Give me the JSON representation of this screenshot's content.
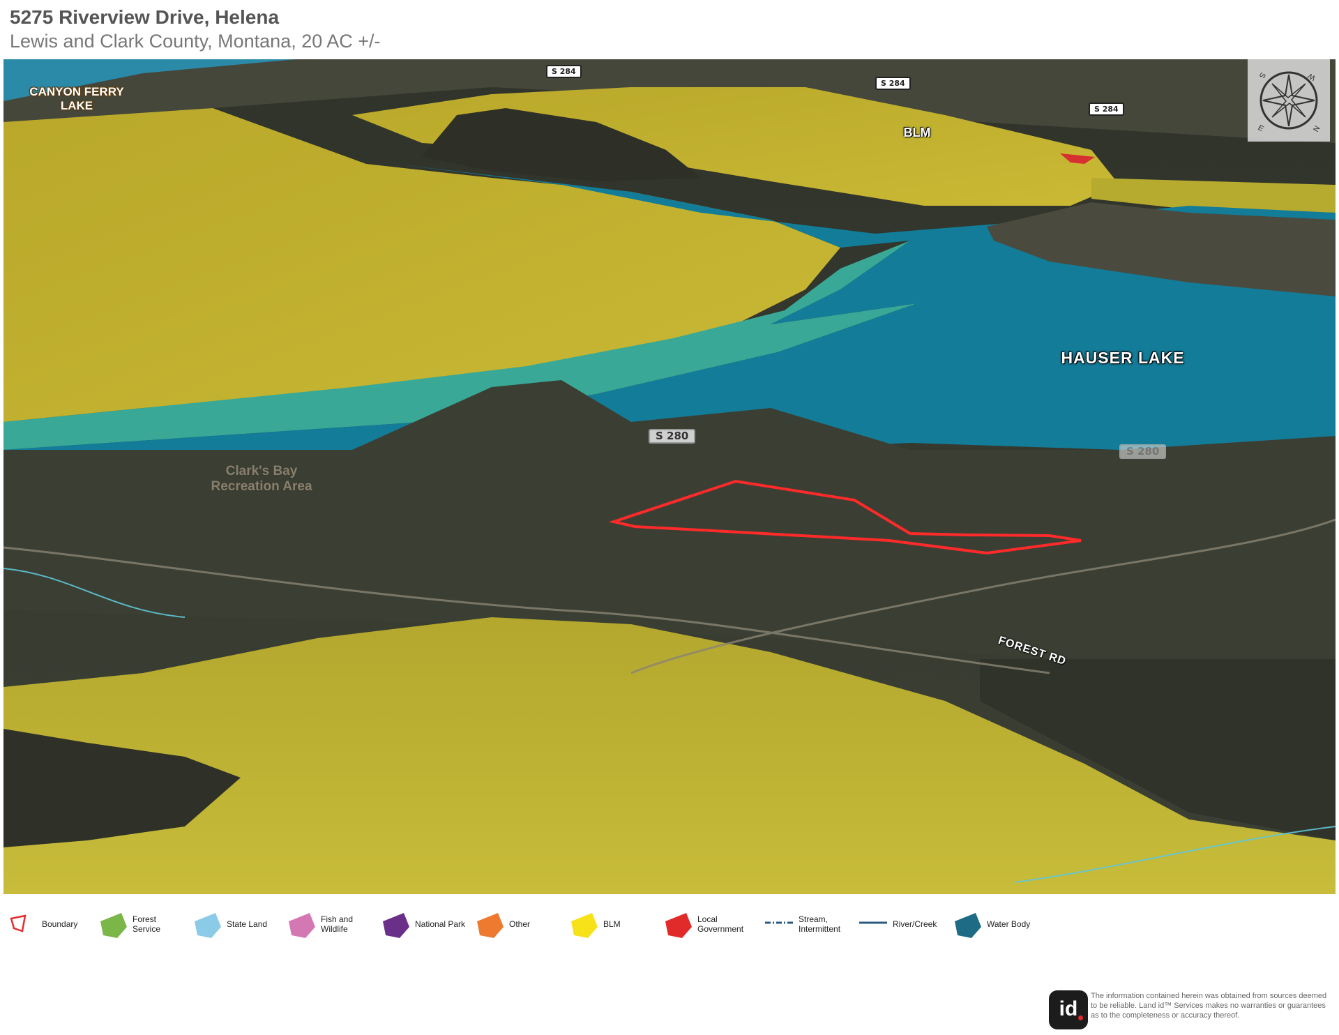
{
  "header": {
    "title": "5275 Riverview Drive, Helena",
    "subtitle": "Lewis and Clark County, Montana, 20 AC +/-"
  },
  "map": {
    "labels": {
      "canyon_ferry_lake": "CANYON FERRY LAKE",
      "blm": "BLM",
      "hauser_lake": "HAUSER LAKE",
      "clarks_bay": "Clark's Bay Recreation Area",
      "forest_rd": "FOREST RD"
    },
    "road_shields": {
      "s284_a": "S 284",
      "s284_b": "S 284",
      "s284_c": "S 284",
      "s280_a": "S 280",
      "s280_b": "S 280"
    },
    "colors": {
      "boundary": "#ff2a2a",
      "blm": "#c8b82e",
      "water": "#137c98",
      "state_land": "#3aa896",
      "terrain": "#3a3f32"
    },
    "compass_icon": "compass-rose-icon"
  },
  "legend": {
    "items": [
      {
        "label": "Boundary",
        "color": "#e03030",
        "icon": "boundary-outline-icon"
      },
      {
        "label": "Forest Service",
        "color": "#7ab648",
        "icon": "pentagon-icon"
      },
      {
        "label": "State Land",
        "color": "#8ccbe8",
        "icon": "pentagon-icon"
      },
      {
        "label": "Fish and Wildlife",
        "color": "#d478b4",
        "icon": "pentagon-icon"
      },
      {
        "label": "National Park",
        "color": "#6a2f88",
        "icon": "pentagon-icon"
      },
      {
        "label": "Other",
        "color": "#ee7a30",
        "icon": "pentagon-icon"
      },
      {
        "label": "BLM",
        "color": "#f7e21a",
        "icon": "pentagon-icon"
      },
      {
        "label": "Local Government",
        "color": "#e12a2a",
        "icon": "pentagon-icon"
      },
      {
        "label": "Stream, Intermittent",
        "color": "#2a5a80",
        "icon": "dash-dot-line-icon"
      },
      {
        "label": "River/Creek",
        "color": "#2a5a80",
        "icon": "solid-line-icon"
      },
      {
        "label": "Water Body",
        "color": "#1d6b84",
        "icon": "pentagon-icon"
      }
    ]
  },
  "footer": {
    "logo_text": "id",
    "disclaimer": "The information contained herein was obtained from sources deemed to be reliable. Land id™ Services makes no warranties or guarantees as to the completeness or accuracy thereof."
  }
}
